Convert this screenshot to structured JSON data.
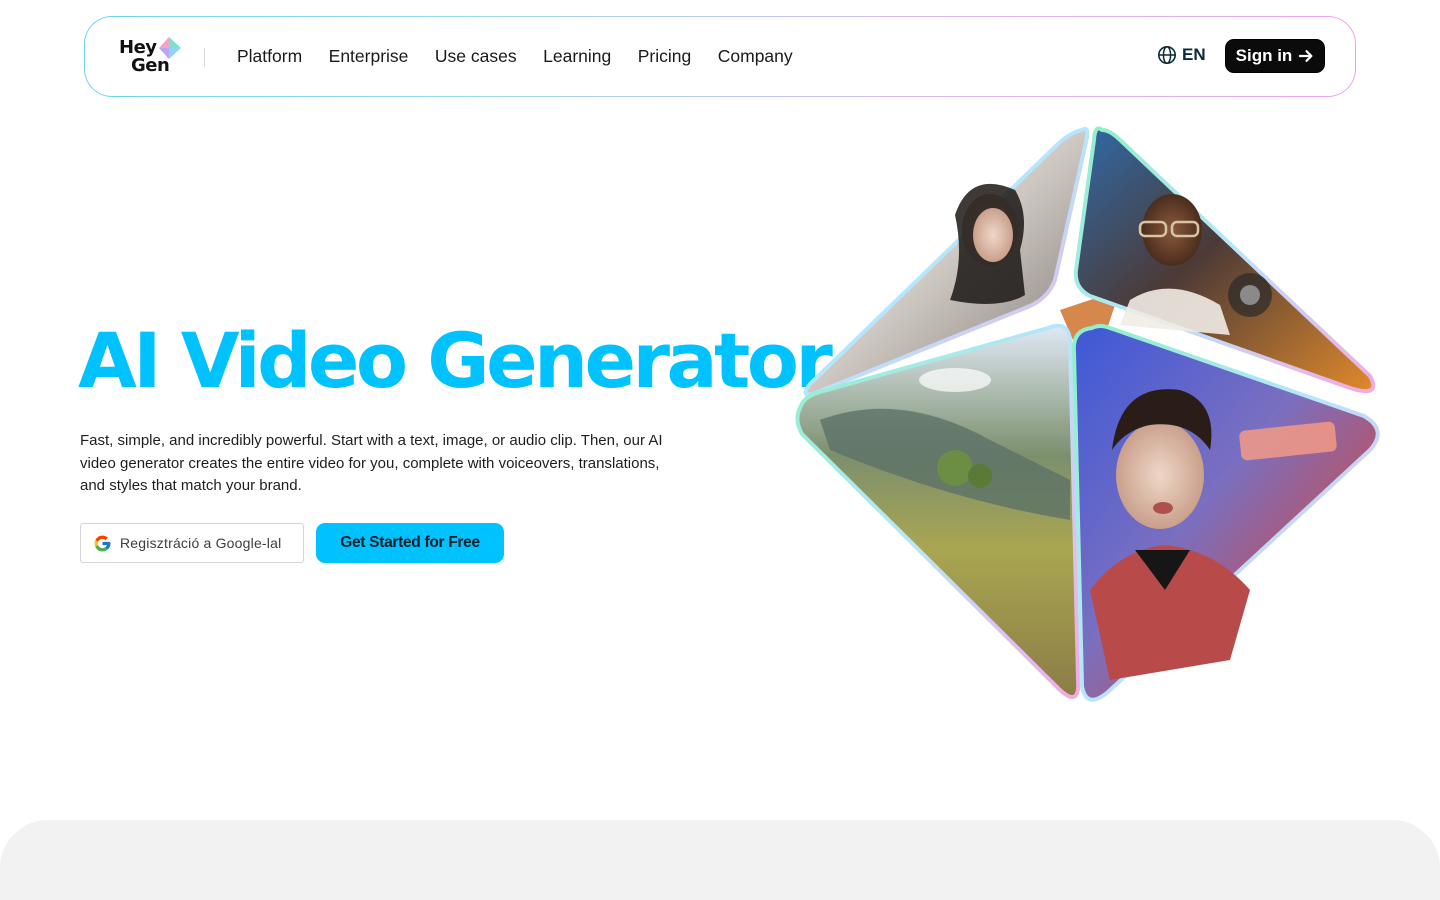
{
  "brand": {
    "logo_line1": "Hey",
    "logo_line2": "Gen",
    "accent_color": "#00c2ff"
  },
  "nav": {
    "links": [
      "Platform",
      "Enterprise",
      "Use cases",
      "Learning",
      "Pricing",
      "Company"
    ],
    "language_label": "EN",
    "language_icon": "globe-icon",
    "signin_label": "Sign in",
    "signin_icon": "arrow-right-icon"
  },
  "hero": {
    "title": "AI Video Generator",
    "description": "Fast, simple, and incredibly powerful. Start with a text, image, or audio clip. Then, our AI video generator creates the entire video for you, complete with voiceovers, translations, and styles that match your brand.",
    "google_button_label": "Regisztráció a Google-lal",
    "google_icon": "google-g-icon",
    "cta_label": "Get Started for Free",
    "cta_color": "#00c2ff"
  }
}
